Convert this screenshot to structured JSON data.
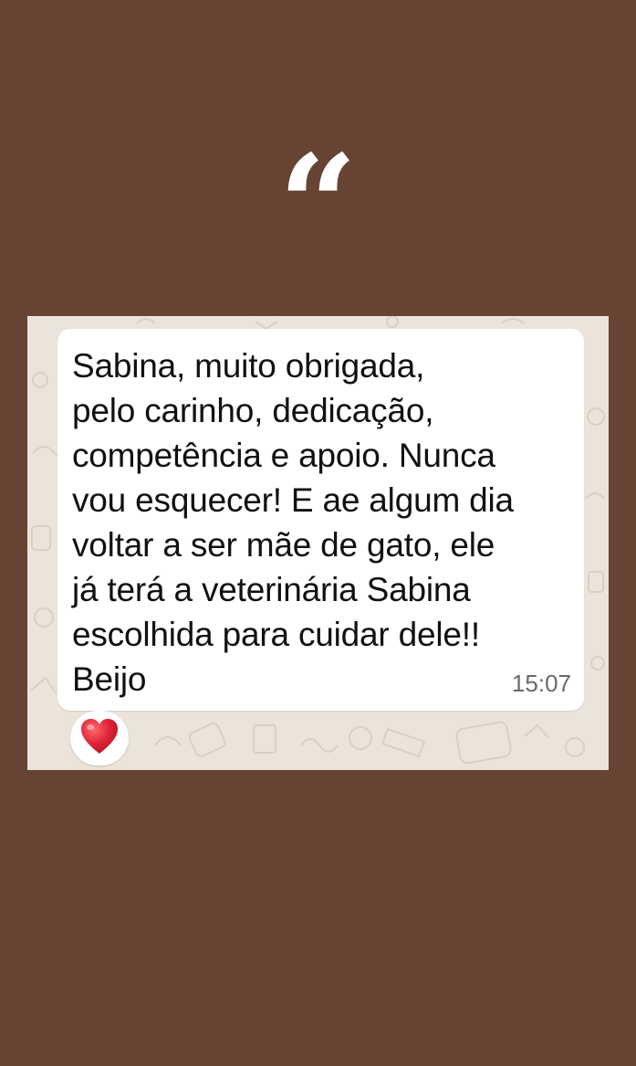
{
  "quote": {
    "mark": "“"
  },
  "message": {
    "text": "Sabina, muito obrigada,\npelo carinho, dedicação,\ncompetência e apoio. Nunca\nvou esquecer! E ae algum dia\nvoltar a ser mãe de gato, ele\njá terá a veterinária Sabina\nescolhida para cuidar dele!!\nBeijo",
    "time": "15:07",
    "reaction_icon": "red-heart-icon"
  },
  "colors": {
    "background": "#674333",
    "chat_wallpaper": "#ece4db",
    "bubble": "#ffffff",
    "heart": "#e0243a"
  }
}
